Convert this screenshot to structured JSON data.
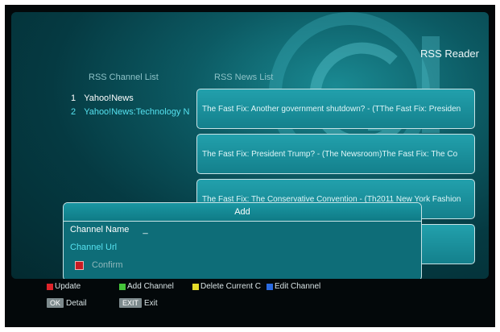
{
  "app_title": "RSS Reader",
  "headers": {
    "channel_list": "RSS Channel List",
    "news_list": "RSS News List"
  },
  "channels": [
    {
      "num": "1",
      "name": "Yahoo!News"
    },
    {
      "num": "2",
      "name": "Yahoo!News:Technology N"
    }
  ],
  "news": [
    "The Fast Fix: Another government shutdown? -   (TThe Fast Fix: Presiden",
    "The Fast Fix: President Trump? -   (The Newsroom)The Fast Fix: The Co",
    "The Fast Fix: The Conservative Convention -   (Th2011 New York Fashion",
    ""
  ],
  "dialog": {
    "title": "Add",
    "channel_name_label": "Channel Name",
    "channel_name_value": "_",
    "channel_url_label": "Channel Url",
    "confirm_label": "Confirm"
  },
  "footer": {
    "update": "Update",
    "add_channel": "Add Channel",
    "delete_current": "Delete Current C",
    "edit_channel": "Edit Channel",
    "ok_key": "OK",
    "detail": "Detail",
    "exit_key": "EXIT",
    "exit": "Exit"
  },
  "colors": {
    "red": "#e0242a",
    "green": "#45c43a",
    "yellow": "#e4dc2a",
    "blue": "#2a6ae0",
    "selected_text": "#56e2f0"
  }
}
